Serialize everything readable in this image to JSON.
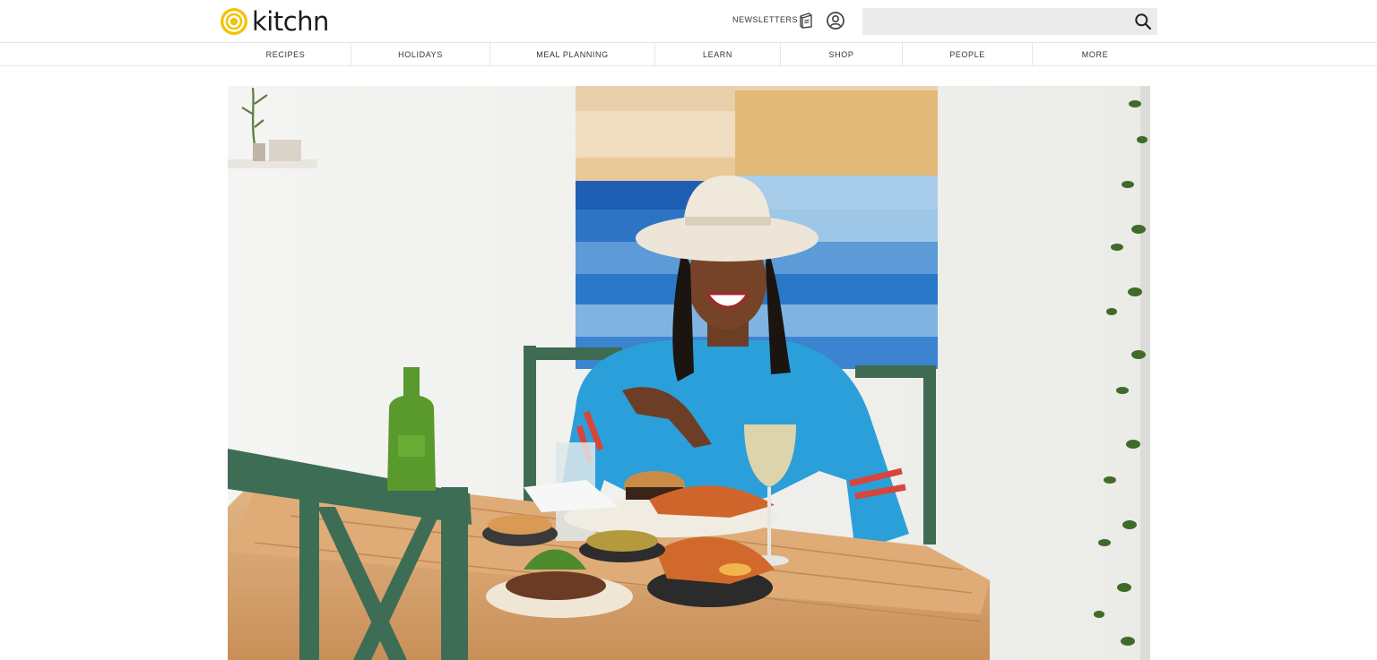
{
  "header": {
    "logo_text": "kitchn",
    "newsletters_label": "NEWSLETTERS",
    "search": {
      "placeholder": "",
      "value": ""
    },
    "icons": [
      "logo-mark-icon",
      "newsletter-icon",
      "user-account-icon",
      "search-icon"
    ]
  },
  "nav": {
    "items": [
      {
        "label": "RECIPES"
      },
      {
        "label": "HOLIDAYS"
      },
      {
        "label": "MEAL PLANNING"
      },
      {
        "label": "LEARN"
      },
      {
        "label": "SHOP"
      },
      {
        "label": "PEOPLE"
      },
      {
        "label": "MORE"
      }
    ]
  },
  "colors": {
    "brand_yellow": "#f2c400",
    "text_dark": "#1c1c1c",
    "search_bg": "#ebebeb",
    "divider": "#e4e4e4"
  }
}
